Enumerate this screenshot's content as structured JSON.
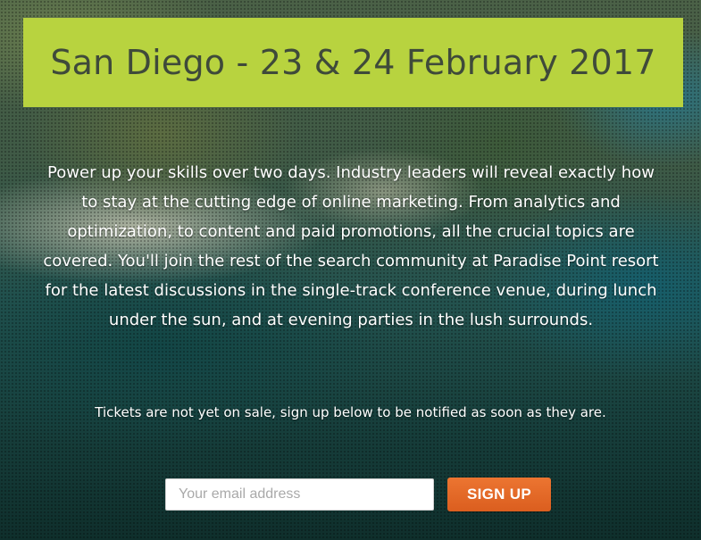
{
  "event": {
    "title": "San Diego - 23 & 24 February 2017",
    "description": "Power up your skills over two days. Industry leaders will reveal exactly how to stay at the cutting edge of online marketing. From analytics and optimization, to content and paid promotions, all the crucial topics are covered. You'll join the rest of the search community at Paradise Point resort for the latest discussions in the single-track conference venue, during lunch under the sun, and at evening parties in the lush surrounds.",
    "ticket_notice": "Tickets are not yet on sale, sign up below to be notified as soon as they are."
  },
  "signup": {
    "email_placeholder": "Your email address",
    "email_value": "",
    "button_label": "SIGN UP"
  },
  "colors": {
    "title_background": "#b8d33f",
    "title_text": "#3f4a3a",
    "button_background": "#e2672a",
    "body_text": "#ffffff"
  }
}
